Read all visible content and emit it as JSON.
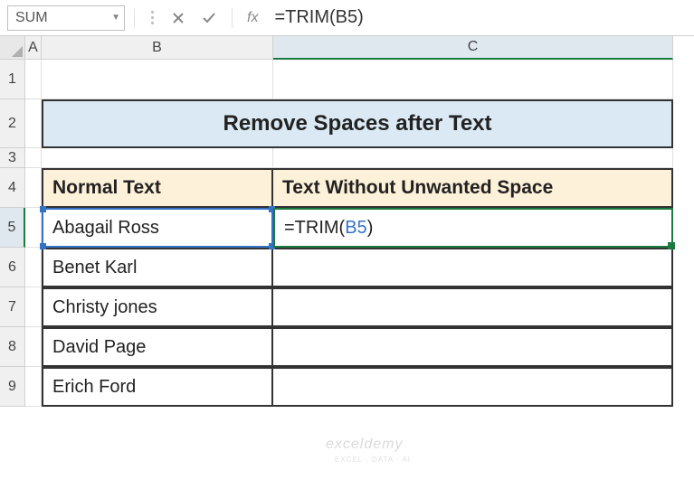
{
  "namebox": "SUM",
  "formula_bar": "=TRIM(B5)",
  "fx_label": "fx",
  "columns": [
    "A",
    "B",
    "C"
  ],
  "rows": [
    "1",
    "2",
    "3",
    "4",
    "5",
    "6",
    "7",
    "8",
    "9"
  ],
  "title": "Remove Spaces after Text",
  "headers": {
    "b": "Normal Text",
    "c": "Text Without Unwanted Space"
  },
  "data": [
    {
      "b": "Abagail   Ross",
      "c_formula": {
        "prefix": "=TRIM(",
        "ref": "B5",
        "suffix": ")"
      }
    },
    {
      "b": "Benet   Karl",
      "c": ""
    },
    {
      "b": "Christy   jones",
      "c": ""
    },
    {
      "b": "David   Page",
      "c": ""
    },
    {
      "b": "Erich   Ford",
      "c": ""
    }
  ],
  "watermark": "exceldemy",
  "watermark_sub": "EXCEL · DATA · AI",
  "chart_data": {
    "type": "table",
    "title": "Remove Spaces after Text",
    "columns": [
      "Normal Text",
      "Text Without Unwanted Space"
    ],
    "rows": [
      [
        "Abagail   Ross",
        "=TRIM(B5)"
      ],
      [
        "Benet   Karl",
        ""
      ],
      [
        "Christy   jones",
        ""
      ],
      [
        "David   Page",
        ""
      ],
      [
        "Erich   Ford",
        ""
      ]
    ]
  }
}
